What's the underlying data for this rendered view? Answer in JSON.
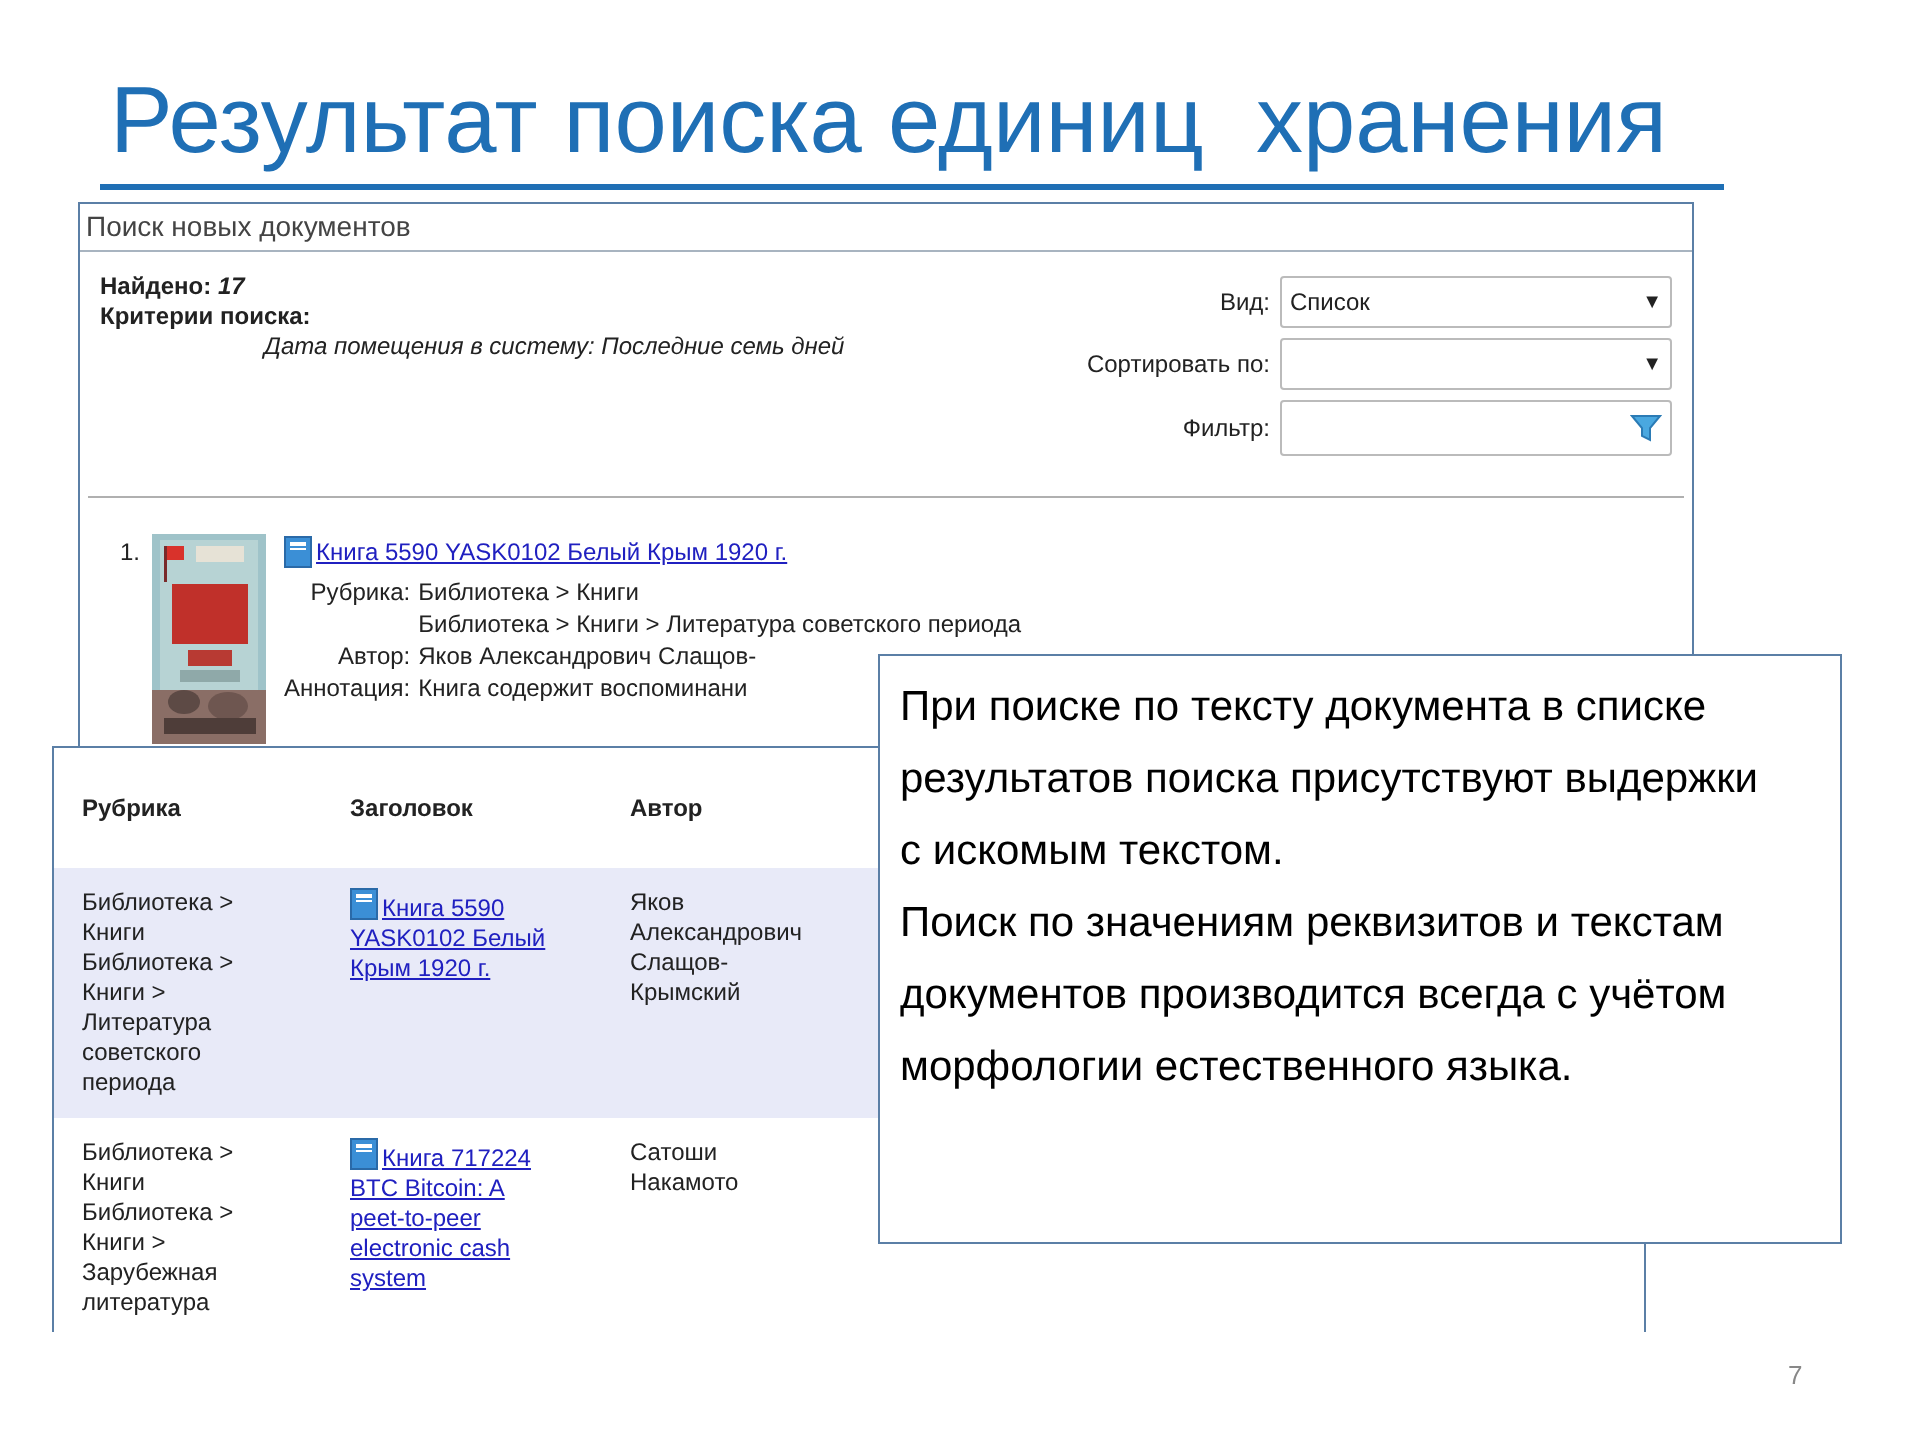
{
  "slide_title": "Результат поиска единиц  хранения",
  "search_window": {
    "title": "Поиск новых документов",
    "found_label": "Найдено:",
    "found_count": "17",
    "criteria_label": "Критерии поиска:",
    "criteria_value": "Дата помещения в систему: Последние семь дней",
    "view": {
      "label": "Вид:",
      "value": "Список",
      "arrow": "▼"
    },
    "sort": {
      "label": "Сортировать по:",
      "arrow": "▼"
    },
    "filter": {
      "label": "Фильтр:"
    },
    "result": {
      "number": "1.",
      "link": "Книга 5590 YASK0102 Белый Крым 1920 г.",
      "fields": [
        {
          "label": "Рубрика:",
          "lines": [
            "Библиотека > Книги",
            "Библиотека > Книги > Литература советского периода"
          ]
        },
        {
          "label": "Автор:",
          "lines": [
            "Яков Александрович Слащов-"
          ]
        },
        {
          "label": "Аннотация:",
          "lines": [
            "Книга содержит воспоминани"
          ]
        }
      ]
    }
  },
  "table_window": {
    "columns": [
      "Рубрика",
      "Заголовок",
      "Автор"
    ],
    "rows": [
      {
        "highlighted": true,
        "rubric": "Библиотека > Книги Библиотека > Книги > Литература советского периода",
        "title": "Книга 5590 YASK0102 Белый Крым 1920 г.",
        "author": "Яков Александрович Слащов-Крымский"
      },
      {
        "highlighted": false,
        "rubric": "Библиотека > Книги Библиотека > Книги > Зарубежная литература",
        "title": "Книга 717224 BTC Bitcoin: A peet-to-peer electronic cash system",
        "author": "Сатоши Накамото"
      }
    ]
  },
  "callout": [
    "При поиске по тексту документа в списке результатов поиска присутствуют выдержки с искомым текстом.",
    "Поиск по значениям реквизитов и текстам документов производится всегда с учётом морфологии естественного языка."
  ],
  "page_number": "7"
}
